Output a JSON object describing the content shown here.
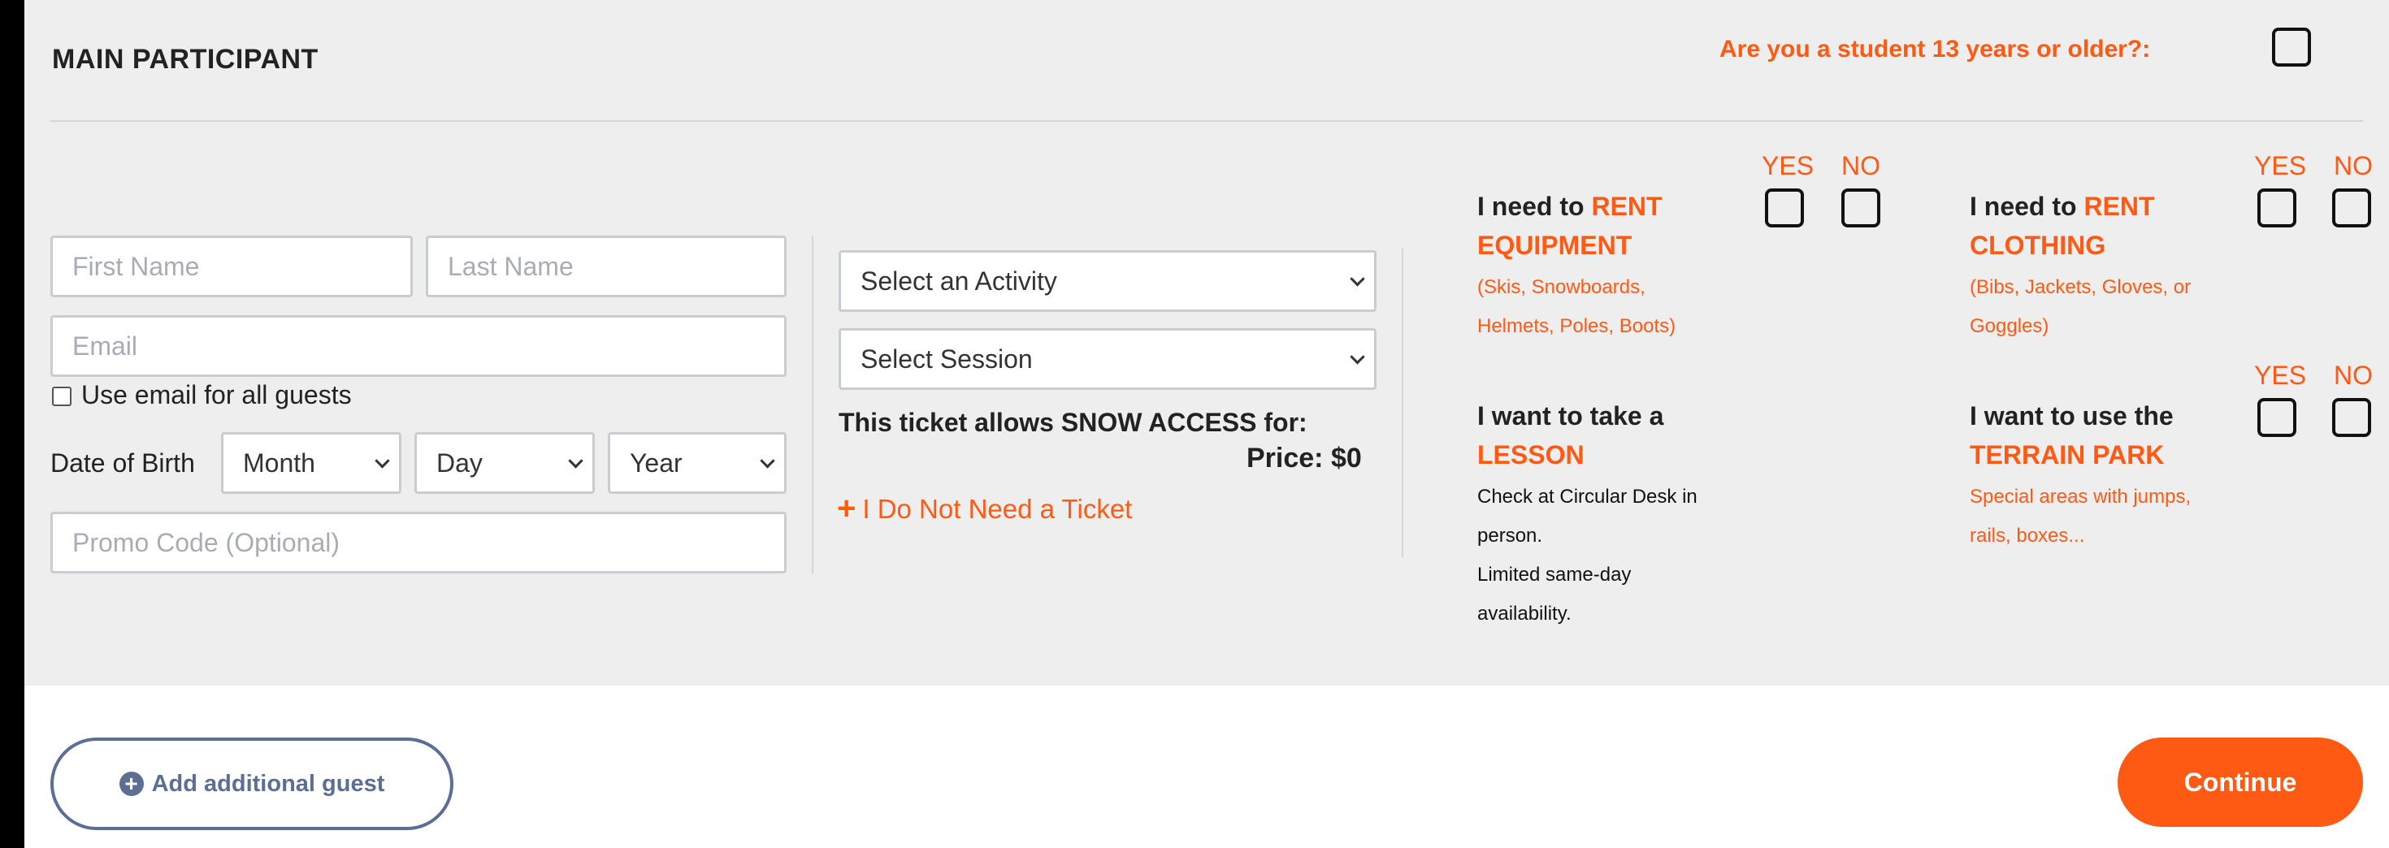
{
  "header": {
    "title": "MAIN PARTICIPANT",
    "student_question": "Are you a student 13 years or older?:"
  },
  "form": {
    "first_name_placeholder": "First Name",
    "last_name_placeholder": "Last Name",
    "email_placeholder": "Email",
    "use_email_label": "Use email for all guests",
    "dob_label": "Date of Birth",
    "month": "Month",
    "day": "Day",
    "year": "Year",
    "promo_placeholder": "Promo Code (Optional)"
  },
  "ticket": {
    "activity": "Select an Activity",
    "session": "Select Session",
    "allows_text": "This ticket allows SNOW ACCESS for:",
    "price_text": "Price: $0",
    "no_ticket_plus": "+",
    "no_ticket_label": "I Do Not Need a Ticket"
  },
  "options": {
    "yes": "YES",
    "no": "NO",
    "rent_equipment": {
      "prefix": "I need to ",
      "highlight1": "RENT",
      "highlight2": "EQUIPMENT",
      "desc1": "(Skis, Snowboards,",
      "desc2": "Helmets, Poles, Boots)"
    },
    "rent_clothing": {
      "prefix": "I need to ",
      "highlight1": "RENT",
      "highlight2": "CLOTHING",
      "desc1": "(Bibs, Jackets, Gloves, or",
      "desc2": "Goggles)"
    },
    "lesson": {
      "line1": "I want to take a",
      "highlight": "LESSON",
      "desc1": "Check at Circular Desk in",
      "desc2": "person.",
      "desc3": "Limited same-day",
      "desc4": "availability."
    },
    "terrain": {
      "line1": "I want to use the",
      "highlight": "TERRAIN PARK",
      "desc1": "Special areas with jumps,",
      "desc2": "rails, boxes..."
    }
  },
  "footer": {
    "add_guest": "Add additional guest",
    "continue": "Continue"
  }
}
